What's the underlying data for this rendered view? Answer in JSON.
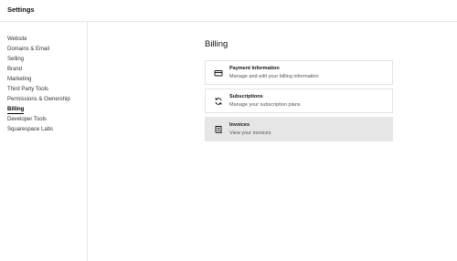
{
  "header": {
    "title": "Settings"
  },
  "sidebar": {
    "items": [
      {
        "label": "Website"
      },
      {
        "label": "Domains & Email"
      },
      {
        "label": "Selling"
      },
      {
        "label": "Brand"
      },
      {
        "label": "Marketing"
      },
      {
        "label": "Third Party Tools"
      },
      {
        "label": "Permissions & Ownership"
      },
      {
        "label": "Billing",
        "active": true
      },
      {
        "label": "Developer Tools"
      },
      {
        "label": "Squarespace Labs"
      }
    ]
  },
  "main": {
    "title": "Billing",
    "cards": [
      {
        "title": "Payment Information",
        "subtitle": "Manage and edit your billing information",
        "icon": "credit-card-icon"
      },
      {
        "title": "Subscriptions",
        "subtitle": "Manage your subscription plans",
        "icon": "refresh-icon"
      },
      {
        "title": "Invoices",
        "subtitle": "View your invoices",
        "icon": "receipt-icon",
        "selected": true
      }
    ]
  },
  "colors": {
    "border": "#e3e3e3",
    "selected_bg": "#e6e6e6",
    "text": "#111111",
    "muted": "#555555"
  }
}
